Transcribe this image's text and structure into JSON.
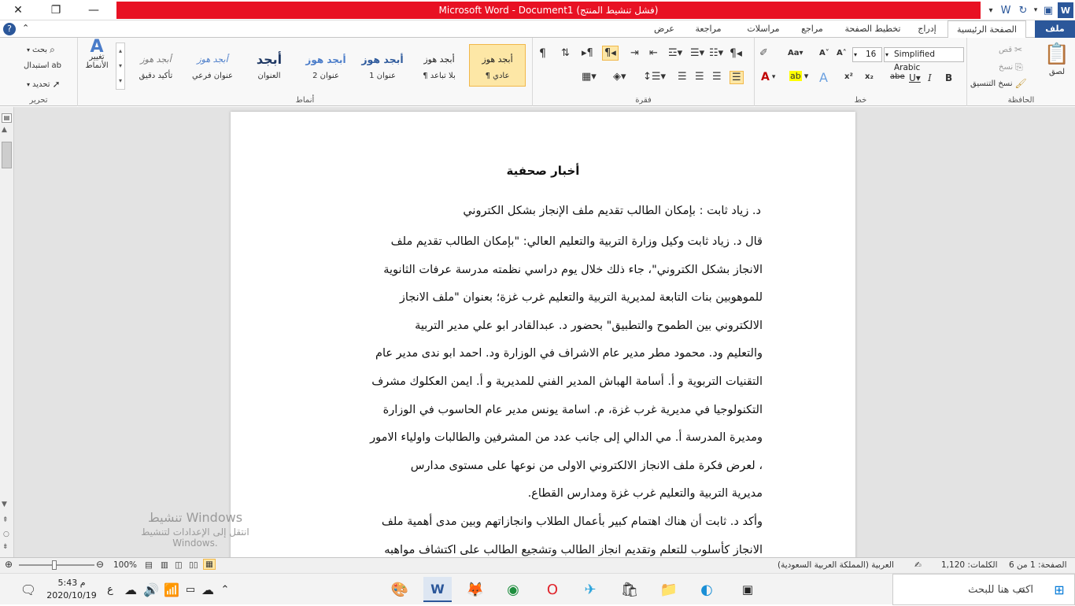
{
  "window": {
    "title": "Microsoft Word  - Document1  (فشل تنشيط المنتج)",
    "close_glyph": "✕",
    "restore_glyph": "❐",
    "minimize_glyph": "—"
  },
  "tabs": [
    {
      "label": "ملف"
    },
    {
      "label": "الصفحة الرئيسية"
    },
    {
      "label": "إدراج"
    },
    {
      "label": "تخطيط الصفحة"
    },
    {
      "label": "مراجع"
    },
    {
      "label": "مراسلات"
    },
    {
      "label": "مراجعة"
    },
    {
      "label": "عرض"
    }
  ],
  "clipboard": {
    "group_label": "الحافظة",
    "paste": "لصق",
    "cut": "قص",
    "copy": "نسخ",
    "format_painter": "نسخ التنسيق"
  },
  "font": {
    "group_label": "خط",
    "name": "Simplified Arabic",
    "size": "16"
  },
  "paragraph": {
    "group_label": "فقرة"
  },
  "styles": {
    "group_label": "أنماط",
    "items": [
      {
        "sample": "أبجد هوز",
        "name": "¶ عادي"
      },
      {
        "sample": "أبجد هوز",
        "name": "¶ بلا تباعد"
      },
      {
        "sample": "أبجد هوز",
        "name": "عنوان 1"
      },
      {
        "sample": "أبجد هوز",
        "name": "عنوان 2"
      },
      {
        "sample": "أبجد",
        "name": "العنوان"
      },
      {
        "sample": "أبجد هوز",
        "name": "عنوان فرعي"
      },
      {
        "sample": "أبجد هوز",
        "name": "تأكيد دقيق"
      }
    ],
    "change_styles": "تغيير الأنماط"
  },
  "editing": {
    "group_label": "تحرير",
    "find": "بحث",
    "replace": "استبدال",
    "select": "تحديد"
  },
  "document": {
    "title": "أخبار صحفية",
    "subtitle": "د. زياد ثابت : بإمكان الطالب تقديم ملف الإنجاز بشكل الكتروني",
    "para1_lines": [
      "قال د. زياد ثابت وكيل وزارة التربية والتعليم العالي: \"بإمكان الطالب تقديم ملف",
      "الانجاز بشكل الكتروني\"، جاء ذلك خلال يوم دراسي نظمته مدرسة عرفات الثانوية",
      "للموهوبين بنات التابعة لمديرية التربية والتعليم غرب غزة؛ بعنوان \"ملف الانجاز",
      "الالكتروني بين الطموح والتطبيق\" بحضور د. عبدالقادر ابو علي مدير التربية",
      "والتعليم ود. محمود مطر مدير عام الاشراف في الوزارة ود. احمد ابو ندى مدير عام",
      "التقنيات التربوية و أ. أسامة الهباش المدير الفني للمديرية و أ. ايمن العكلوك مشرف",
      "التكنولوجيا في مديرية غرب غزة، م. اسامة يونس مدير عام الحاسوب في الوزارة",
      "ومديرة المدرسة أ. مي الدالي إلى جانب عدد من المشرفين والطالبات واولياء الامور",
      "، لعرض فكرة ملف الانجاز الالكتروني الاولى من نوعها على مستوى مدارس",
      "مديرية التربية والتعليم غرب غزة ومدارس القطاع."
    ],
    "para2_lines": [
      "وأكد د. ثابت أن هناك اهتمام كبير بأعمال الطلاب وانجازاتهم وبين مدى أهمية ملف",
      "الانجاز كأسلوب للتعلم وتقديم انجاز الطالب وتشجيع الطالب على اكتشاف مواهبه"
    ]
  },
  "watermark": {
    "line1": "تنشيط Windows",
    "line2": "انتقل إلى الإعدادات لتنشيط Windows."
  },
  "status": {
    "page": "الصفحة: 1 من 6",
    "words": "الكلمات: 1,120",
    "language": "العربية (المملكة العربية السعودية)",
    "zoom": "100%"
  },
  "taskbar": {
    "search_placeholder": "اكتب هنا للبحث",
    "time": "5:43 م",
    "date": "2020/10/19",
    "lang": "ع"
  }
}
